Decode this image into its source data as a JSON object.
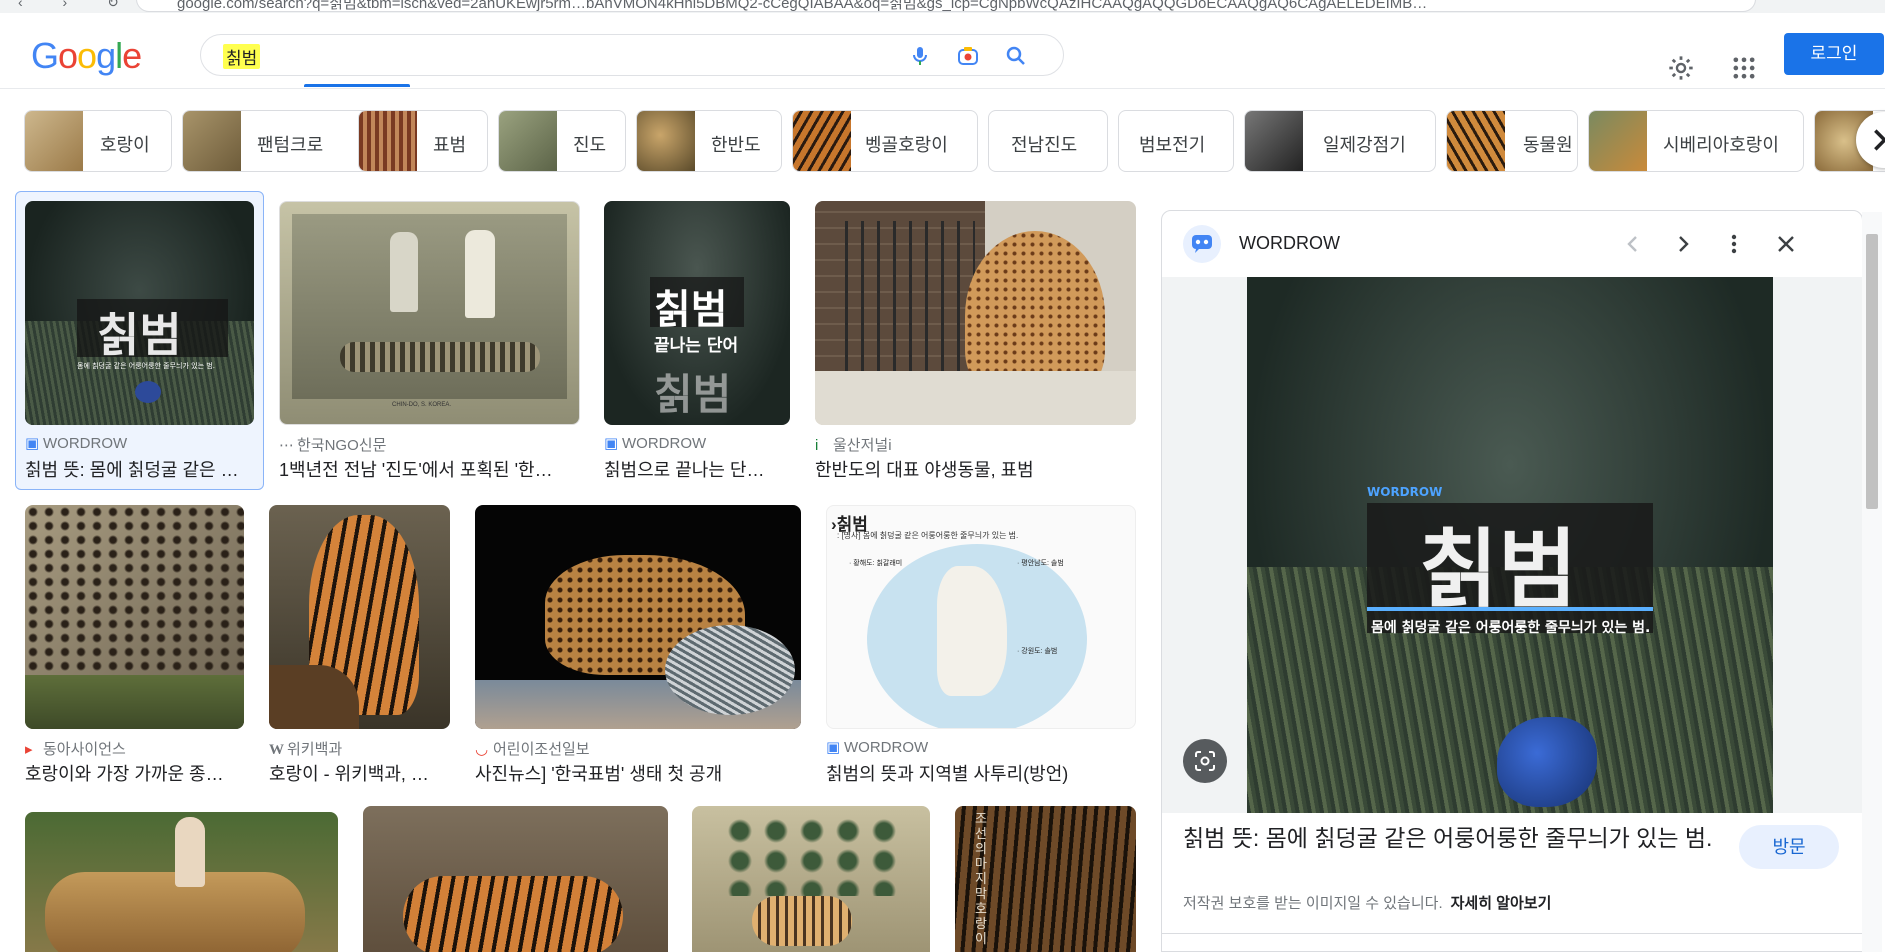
{
  "browser": {
    "url": "google.com/search?q=칡범&tbm=isch&ved=2ahUKEwjr5rm…bAhVMON4kHhi5DBMQ2-cCegQIABAA&oq=칡범&gs_lcp=CgNpbWcQAzIHCAAQgAQQGDoECAAQgAQ6CAgAELEDEIMB…"
  },
  "header": {
    "logo": [
      "G",
      "o",
      "o",
      "g",
      "l",
      "e"
    ],
    "search_query": "칡범",
    "login_label": "로그인"
  },
  "chips": [
    {
      "label": "호랑이",
      "color": "#b89a6a"
    },
    {
      "label": "팬텀크로",
      "color": "#8a7a55"
    },
    {
      "label": "표범",
      "color": "#9a5a3a"
    },
    {
      "label": "진도",
      "color": "#7d8466"
    },
    {
      "label": "한반도",
      "color": "#8a7448"
    },
    {
      "label": "벵골호랑이",
      "color": "#a0622e"
    },
    {
      "label": "전남진도",
      "color": ""
    },
    {
      "label": "범보전기",
      "color": ""
    },
    {
      "label": "일제강점기",
      "color": "#4a4a4a"
    },
    {
      "label": "동물원",
      "color": "#b07a3a"
    },
    {
      "label": "시베리아호랑이",
      "color": "#6b7a5a"
    },
    {
      "label": "",
      "color": "#c9b58a"
    }
  ],
  "results": [
    {
      "source": "WORDROW",
      "title": "칡범 뜻: 몸에 칡덩굴 같은 …"
    },
    {
      "source": "한국NGO신문",
      "title": "1백년전 전남 '진도'에서 포획된 '한…"
    },
    {
      "source": "WORDROW",
      "title": "칡범으로 끝나는 단…"
    },
    {
      "source": "울산저널i",
      "title": "한반도의 대표 야생동물, 표범"
    },
    {
      "source": "동아사이언스",
      "title": "호랑이와 가장 가까운 종…"
    },
    {
      "source": "위키백과",
      "title": "호랑이 - 위키백과, …"
    },
    {
      "source": "어린이조선일보",
      "title": "사진뉴스] '한국표범' 생태 첫 공개"
    },
    {
      "source": "WORDROW",
      "title": "칡범의 뜻과 지역별 사투리(방언)"
    }
  ],
  "image_text": {
    "card1_word": "칡범",
    "card1_sub": "몸에 칡덩굴 같은 어룽어룽한 줄무늬가 있는 범.",
    "card3_word": "칡범",
    "card3_sub": "끝나는 단어",
    "card3_word2": "칡범",
    "card8_head": "›칡범",
    "card8_line": ": [명사] 몸에 칡덩굴 같은 어룽어룽한 줄무늬가 있는 범.",
    "card8_l1": "· 황해도: 칡갈래미",
    "card8_l2": "· 평안남도: 솔범",
    "card8_l3": "· 강원도: 솔범",
    "card2_caption": "CHIN-DO, S. KOREA.",
    "card12_vertical": "조선의 마지막 호랑이",
    "panel_brand": "WORDROW",
    "panel_word": "칡범",
    "panel_sub": "몸에 칡덩굴 같은 어룽어룽한 줄무늬가 있는 범."
  },
  "panel": {
    "source_name": "WORDROW",
    "title": "칡범 뜻: 몸에 칡덩굴 같은 어룽어룽한 줄무늬가 있는 범.",
    "visit_label": "방문",
    "copyright_note": "저작권 보호를 받는 이미지일 수 있습니다.",
    "learn_more": "자세히 알아보기"
  }
}
